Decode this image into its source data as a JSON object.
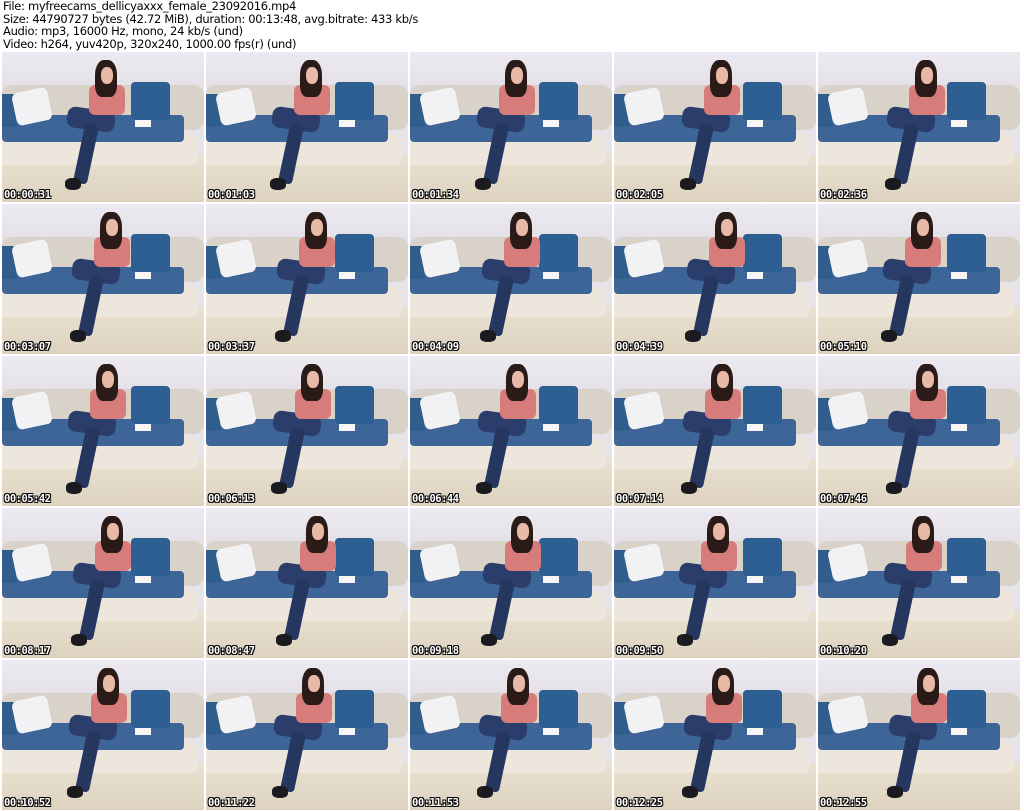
{
  "header": {
    "file": "File: myfreecams_dellicyaxxx_female_23092016.mp4",
    "size": "Size: 44790727 bytes (42.72 MiB), duration: 00:13:48, avg.bitrate: 433 kb/s",
    "audio": "Audio: mp3, 16000 Hz, mono, 24 kb/s (und)",
    "video": "Video: h264, yuv420p, 320x240, 1000.00 fps(r) (und)"
  },
  "thumbnails": [
    "00:00:31",
    "00:01:03",
    "00:01:34",
    "00:02:05",
    "00:02:36",
    "00:03:07",
    "00:03:37",
    "00:04:09",
    "00:04:39",
    "00:05:10",
    "00:05:42",
    "00:06:13",
    "00:06:44",
    "00:07:14",
    "00:07:46",
    "00:08:17",
    "00:08:47",
    "00:09:18",
    "00:09:50",
    "00:10:20",
    "00:10:52",
    "00:11:22",
    "00:11:53",
    "00:12:25",
    "00:12:55"
  ]
}
